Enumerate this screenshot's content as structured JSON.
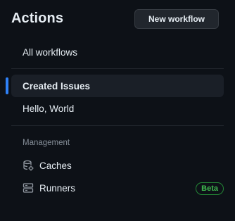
{
  "header": {
    "title": "Actions",
    "new_workflow_label": "New workflow"
  },
  "nav": {
    "all_workflows": "All workflows",
    "workflows": [
      {
        "label": "Created Issues",
        "selected": true
      },
      {
        "label": "Hello, World",
        "selected": false
      }
    ]
  },
  "management": {
    "section_label": "Management",
    "items": [
      {
        "label": "Caches",
        "icon": "database-icon"
      },
      {
        "label": "Runners",
        "icon": "server-icon",
        "badge": "Beta"
      }
    ]
  },
  "colors": {
    "background": "#0d1117",
    "accent": "#2f81f7",
    "badge": "#3fb950"
  }
}
